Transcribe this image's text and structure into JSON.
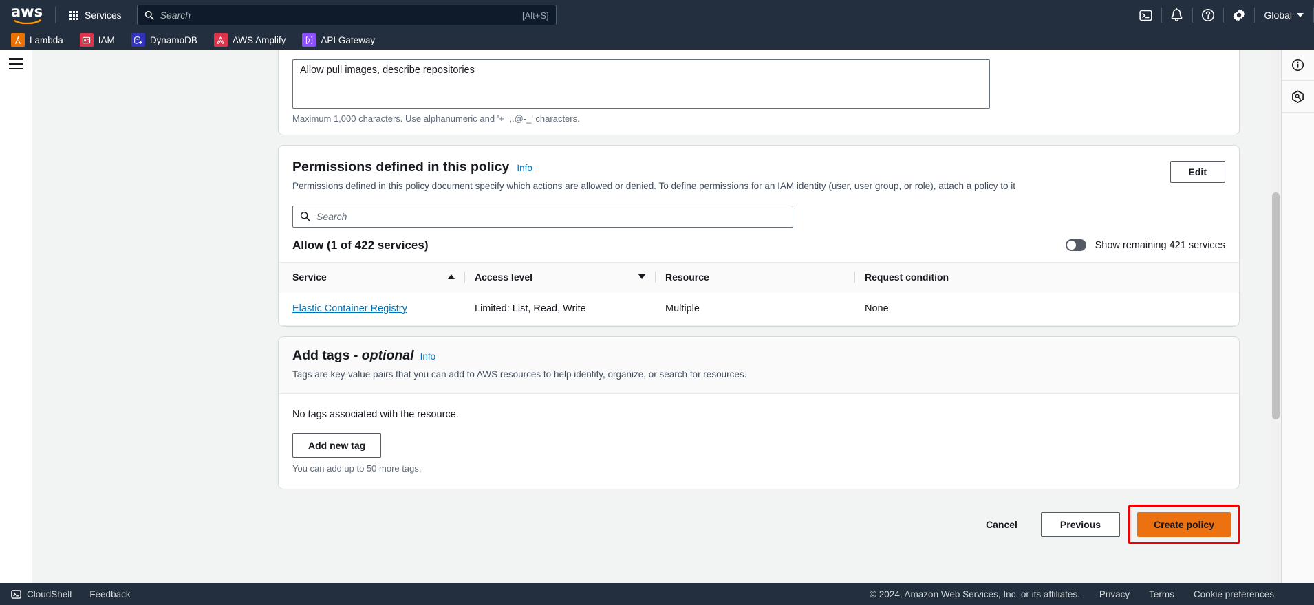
{
  "topnav": {
    "logo_text": "aws",
    "services_label": "Services",
    "search_placeholder": "Search",
    "search_value": "",
    "search_shortcut": "[Alt+S]",
    "icons": [
      "cloudshell-icon",
      "notifications-bell-icon",
      "help-question-icon",
      "settings-gear-icon"
    ],
    "region_label": "Global"
  },
  "favorites": [
    {
      "label": "Lambda",
      "icon": "lambda-icon",
      "color": "#ed7100",
      "glyph": "λ"
    },
    {
      "label": "IAM",
      "icon": "iam-icon",
      "color": "#dd344c",
      "glyph": "⊟"
    },
    {
      "label": "DynamoDB",
      "icon": "dynamodb-icon",
      "color": "#3334b9",
      "glyph": "⌸"
    },
    {
      "label": "AWS Amplify",
      "icon": "amplify-icon",
      "color": "#dd344c",
      "glyph": "△"
    },
    {
      "label": "API Gateway",
      "icon": "apigateway-icon",
      "color": "#8c4fff",
      "glyph": "⨍"
    }
  ],
  "right_rail": [
    {
      "icon": "info-circle-icon"
    },
    {
      "icon": "security-shield-key-icon"
    }
  ],
  "description_card": {
    "textarea_value": "Allow pull images, describe repositories",
    "textarea_placeholder": "",
    "hint": "Maximum 1,000 characters. Use alphanumeric and '+=,.@-_' characters."
  },
  "permissions_card": {
    "title": "Permissions defined in this policy",
    "info_label": "Info",
    "description": "Permissions defined in this policy document specify which actions are allowed or denied. To define permissions for an IAM identity (user, user group, or role), attach a policy to it",
    "edit_label": "Edit",
    "search_placeholder": "Search",
    "search_value": "",
    "allow_summary": "Allow (1 of 422 services)",
    "toggle_label": "Show remaining 421 services",
    "toggle_state": "off",
    "columns": [
      {
        "label": "Service",
        "sort": "asc"
      },
      {
        "label": "Access level",
        "sort": "desc"
      },
      {
        "label": "Resource",
        "sort": "none"
      },
      {
        "label": "Request condition",
        "sort": "none"
      }
    ],
    "rows": [
      {
        "service": "Elastic Container Registry",
        "access_level": "Limited: List, Read, Write",
        "resource": "Multiple",
        "request_condition": "None"
      }
    ]
  },
  "tags_card": {
    "title_main": "Add tags - ",
    "title_optional": "optional",
    "info_label": "Info",
    "description": "Tags are key-value pairs that you can add to AWS resources to help identify, organize, or search for resources.",
    "empty_note": "No tags associated with the resource.",
    "add_tag_label": "Add new tag",
    "limit_note": "You can add up to 50 more tags."
  },
  "actions": {
    "cancel_label": "Cancel",
    "previous_label": "Previous",
    "create_label": "Create policy",
    "highlight_color": "#ee0000",
    "primary_color": "#ec7211"
  },
  "footer": {
    "cloudshell_label": "CloudShell",
    "feedback_label": "Feedback",
    "copyright": "© 2024, Amazon Web Services, Inc. or its affiliates.",
    "links": [
      "Privacy",
      "Terms",
      "Cookie preferences"
    ]
  }
}
